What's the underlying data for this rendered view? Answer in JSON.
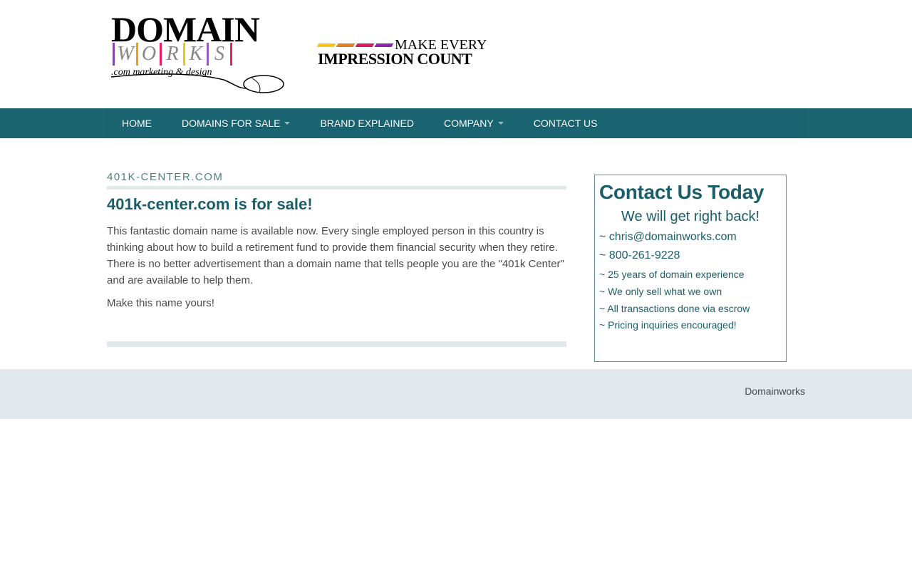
{
  "header": {
    "logo": {
      "word1": "DOMAIN",
      "letters": [
        "W",
        "O",
        "R",
        "K",
        "S"
      ],
      "tag": ".com marketing & design"
    },
    "tagline": {
      "line1": "MAKE EVERY",
      "line2": "IMPRESSION COUNT"
    }
  },
  "nav": {
    "items": [
      {
        "label": "HOME"
      },
      {
        "label": "DOMAINS FOR SALE"
      },
      {
        "label": "BRAND EXPLAINED"
      },
      {
        "label": "COMPANY"
      },
      {
        "label": "CONTACT US"
      }
    ]
  },
  "main": {
    "small_title": "401K-CENTER.COM",
    "title": "401k-center.com is for sale!",
    "paragraphs": [
      "This fantastic domain name is available now. Every single employed person in this country is thinking about how to build a retirement fund to provide them financial security when they retire. There is no better advertisement than a domain name that tells people you are the \"401k Center\" and are available to help them.",
      "Make this name yours!"
    ]
  },
  "sidebar": {
    "heading": "Contact Us Today",
    "subheading": "We will get right back!",
    "lines": [
      "~ chris@domainworks.com",
      "~ 800-261-9228",
      "~ 25 years of domain experience",
      "~ We only sell what we own",
      "~ All transactions done via escrow",
      "~ Pricing inquiries encouraged!"
    ]
  },
  "footer": {
    "text": "Domainworks"
  },
  "colors": {
    "nav_bg": "#196470",
    "title": "#1b5e6a",
    "footer_bg": "#e1e9ec"
  }
}
